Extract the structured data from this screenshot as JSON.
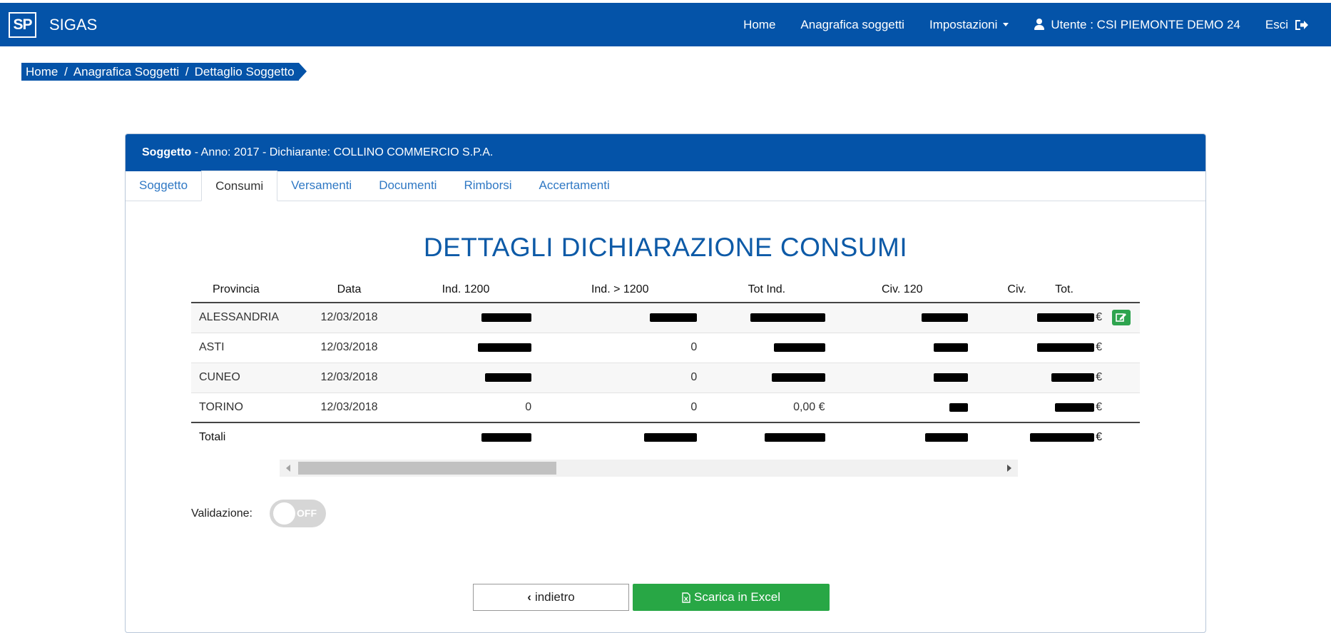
{
  "app": {
    "logo": "SP",
    "title": "SIGAS"
  },
  "nav": {
    "home": "Home",
    "anagrafica": "Anagrafica soggetti",
    "impostazioni": "Impostazioni",
    "user": "Utente : CSI PIEMONTE DEMO 24",
    "logout": "Esci"
  },
  "breadcrumb": [
    "Home",
    "Anagrafica Soggetti",
    "Dettaglio Soggetto"
  ],
  "panel": {
    "header_bold": "Soggetto",
    "header_rest": " - Anno: 2017 - Dichiarante: COLLINO COMMERCIO S.P.A."
  },
  "tabs": [
    "Soggetto",
    "Consumi",
    "Versamenti",
    "Documenti",
    "Rimborsi",
    "Accertamenti"
  ],
  "active_tab": "Consumi",
  "section_title": "DETTAGLI DICHIARAZIONE CONSUMI",
  "table": {
    "headers": [
      "Provincia",
      "Data",
      "Ind. 1200",
      "Ind. > 1200",
      "Tot Ind.",
      "Civ. 120",
      "Civ.",
      "Tot."
    ],
    "rows": [
      {
        "provincia": "ALESSANDRIA",
        "data": "12/03/2018",
        "ind1200": "",
        "ind_gt1200": "",
        "tot_ind": "",
        "civ120": "",
        "tot": "€"
      },
      {
        "provincia": "ASTI",
        "data": "12/03/2018",
        "ind1200": "",
        "ind_gt1200": "0",
        "tot_ind": "",
        "civ120": "",
        "tot": "€"
      },
      {
        "provincia": "CUNEO",
        "data": "12/03/2018",
        "ind1200": "",
        "ind_gt1200": "0",
        "tot_ind": "",
        "civ120": "",
        "tot": "€"
      },
      {
        "provincia": "TORINO",
        "data": "12/03/2018",
        "ind1200": "0",
        "ind_gt1200": "0",
        "tot_ind": "0,00 €",
        "civ120": "",
        "tot": "€"
      }
    ],
    "totals_label": "Totali",
    "totals_tot": "€"
  },
  "validation": {
    "label": "Validazione:",
    "state": "OFF"
  },
  "buttons": {
    "back": "indietro",
    "excel": "Scarica in Excel"
  },
  "colors": {
    "primary": "#0453a8",
    "success": "#28a745",
    "link": "#2f78c4"
  }
}
